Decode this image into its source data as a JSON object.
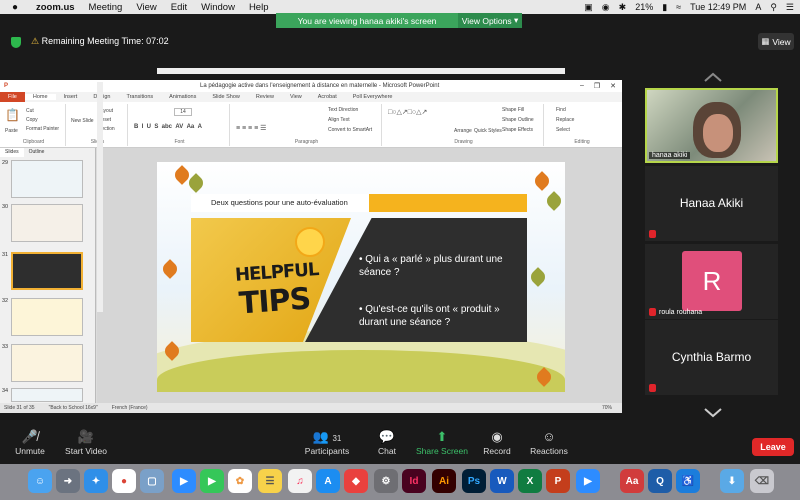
{
  "menubar": {
    "app": "zoom.us",
    "items": [
      "Meeting",
      "View",
      "Edit",
      "Window",
      "Help"
    ],
    "battery": "21%",
    "clock": "Tue 12:49 PM",
    "input_source": "A"
  },
  "share": {
    "banner": "You are viewing hanaa akiki's screen",
    "view_options": "View Options"
  },
  "meeting": {
    "remaining": "Remaining Meeting Time: 07:02",
    "view_label": "View"
  },
  "powerpoint": {
    "window_title": "La pédagogie active  dans l'enseignement à distance  en maternelle  -  Microsoft PowerPoint",
    "tabs": [
      "File",
      "Home",
      "Insert",
      "Design",
      "Transitions",
      "Animations",
      "Slide Show",
      "Review",
      "View",
      "Acrobat",
      "Poll Everywhere"
    ],
    "ribbon_groups": [
      "Clipboard",
      "Slides",
      "Font",
      "Paragraph",
      "Drawing",
      "Editing"
    ],
    "clipboard": [
      "Paste",
      "Cut",
      "Copy",
      "Format Painter"
    ],
    "slides_group": [
      "New Slide",
      "Layout",
      "Reset",
      "Section"
    ],
    "paragraph_cmds": [
      "Text Direction",
      "Align Text",
      "Convert to SmartArt"
    ],
    "drawing_cmds": [
      "Arrange",
      "Quick Styles",
      "Shape Fill",
      "Shape Outline",
      "Shape Effects"
    ],
    "editing_cmds": [
      "Find",
      "Replace",
      "Select"
    ],
    "font_size": "14",
    "panel_tabs": [
      "Slides",
      "Outline"
    ],
    "thumb_numbers": [
      "29",
      "30",
      "31",
      "32",
      "33",
      "34"
    ],
    "status": {
      "slide": "Slide 31 of 35",
      "theme": "\"Back to School 16x9\"",
      "language": "French (France)",
      "zoom": "70%"
    }
  },
  "slide": {
    "header": "Deux questions pour une auto-évaluation",
    "helpful": "HELPFUL",
    "tips": "TIPS",
    "bullet1": "Qui a « parlé » plus durant une séance ?",
    "bullet2": "Qu'est-ce qu'ils ont « produit » durant une séance ?"
  },
  "participants": [
    {
      "name": "hanaa akiki",
      "type": "video"
    },
    {
      "name": "Hanaa Akiki",
      "type": "name"
    },
    {
      "name": "roula rouhana",
      "type": "avatar",
      "initial": "R",
      "color": "#e04f7b"
    },
    {
      "name": "Cynthia Barmo",
      "type": "name"
    }
  ],
  "toolbar": {
    "unmute": "Unmute",
    "start_video": "Start Video",
    "participants": "Participants",
    "participants_count": "31",
    "chat": "Chat",
    "share_screen": "Share Screen",
    "record": "Record",
    "reactions": "Reactions",
    "leave": "Leave"
  },
  "dock": [
    "Finder",
    "Launchpad",
    "Safari",
    "Chrome",
    "Preview",
    "Zoom",
    "FaceTime",
    "Photos",
    "Notes",
    "Music",
    "App Store",
    "AnyDesk",
    "System Preferences",
    "InDesign",
    "Illustrator",
    "Photoshop",
    "Word",
    "Excel",
    "PowerPoint",
    "Zoom",
    "Dictionary",
    "QuickTime",
    "Accessibility",
    "Downloads",
    "Trash"
  ],
  "colors": {
    "share_green": "#3ba55c",
    "leave_red": "#e02828",
    "accent_yellow": "#f5b31e",
    "avatar_pink": "#e04f7b"
  }
}
